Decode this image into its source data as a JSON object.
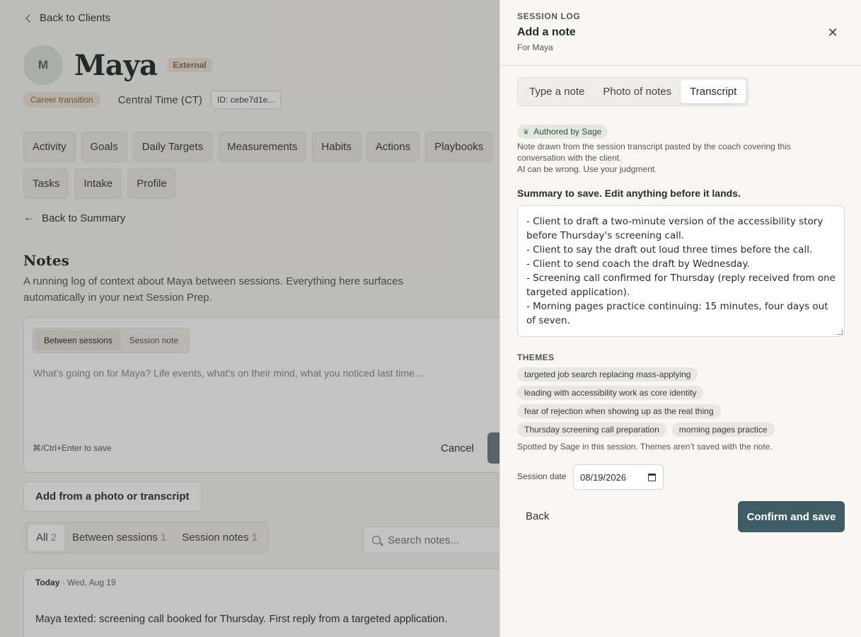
{
  "background": {
    "back_to_clients": "Back to Clients",
    "client": {
      "avatar_initial": "M",
      "name": "Maya",
      "badge": "External",
      "tag": "Career transition",
      "timezone": "Central Time (CT)",
      "id": "ID: cebe7d1e..."
    },
    "tabs_row1": [
      "Activity",
      "Goals",
      "Daily Targets",
      "Measurements",
      "Habits",
      "Actions",
      "Playbooks"
    ],
    "tabs_row2": [
      "Tasks",
      "Intake",
      "Profile"
    ],
    "back_to_summary": "Back to Summary",
    "notes_title": "Notes",
    "notes_desc": "A running log of context about Maya between sessions. Everything here surfaces automatically in your next Session Prep.",
    "compose": {
      "segments": [
        "Between sessions",
        "Session note"
      ],
      "placeholder": "What’s going on for Maya? Life events, what’s on their mind, what you noticed last time…",
      "hint": "⌘/Ctrl+Enter to save",
      "cancel": "Cancel"
    },
    "add_photo": "Add from a photo or transcript",
    "filters": [
      {
        "label": "All",
        "count": "2"
      },
      {
        "label": "Between sessions",
        "count": "1"
      },
      {
        "label": "Session notes",
        "count": "1"
      }
    ],
    "search_placeholder": "Search notes...",
    "note": {
      "day": "Today",
      "sep": "·",
      "date": "Wed, Aug 19",
      "text": "Maya texted: screening call booked for Thursday. First reply from a targeted application."
    }
  },
  "drawer": {
    "eyebrow": "SESSION LOG",
    "title": "Add a note",
    "subtitle": "For Maya",
    "close_icon": "close-icon",
    "modes": [
      "Type a note",
      "Photo of notes",
      "Transcript"
    ],
    "active_mode": "Transcript",
    "authored_pill": "Authored by Sage",
    "sage_note_1": "Note drawn from the session transcript pasted by the coach covering this conversation with the client.",
    "sage_note_2": "AI can be wrong. Use your judgment.",
    "summary_label": "Summary to save. Edit anything before it lands.",
    "summary_text": "- Client to draft a two-minute version of the accessibility story before Thursday's screening call.\n- Client to say the draft out loud three times before the call.\n- Client to send coach the draft by Wednesday.\n- Screening call confirmed for Thursday (reply received from one targeted application).\n- Morning pages practice continuing: 15 minutes, four days out of seven.",
    "themes_label": "THEMES",
    "themes": [
      "targeted job search replacing mass-applying",
      "leading with accessibility work as core identity",
      "fear of rejection when showing up as the real thing",
      "Thursday screening call preparation",
      "morning pages practice"
    ],
    "themes_note": "Spotted by Sage in this session. Themes aren’t saved with the note.",
    "session_date_label": "Session date",
    "session_date_value": "08/19/2026",
    "back_label": "Back",
    "confirm_label": "Confirm and save",
    "accent_color": "#3f5b63"
  }
}
